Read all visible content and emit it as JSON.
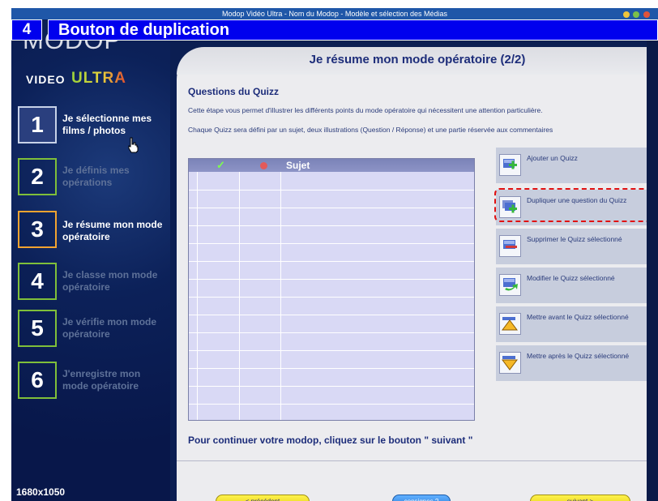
{
  "window": {
    "title": "Modop Vidéo Ultra - Nom du Modop - Modèle et sélection des Médias"
  },
  "caption": {
    "number": "4",
    "title": "Bouton de duplication"
  },
  "sidebar": {
    "logo_main": "MODOP",
    "logo_video": "VIDEO",
    "logo_ultra": "ULTRA",
    "steps": [
      {
        "num": "1",
        "label": "Je sélectionne mes films / photos"
      },
      {
        "num": "2",
        "label": "Je définis mes opérations"
      },
      {
        "num": "3",
        "label": "Je résume mon mode opératoire"
      },
      {
        "num": "4",
        "label": "Je classe mon mode opératoire"
      },
      {
        "num": "5",
        "label": "Je vérifie mon mode opératoire"
      },
      {
        "num": "6",
        "label": "J'enregistre mon mode opératoire"
      }
    ],
    "resolution": "1680x1050"
  },
  "main": {
    "title": "Je résume mon mode opératoire (2/2)",
    "section_title": "Questions du Quizz",
    "desc1": "Cette étape vous permet d'illustrer les différents points du mode opératoire qui nécessitent une attention particulière.",
    "desc2": "Chaque Quizz sera défini par un sujet, deux illustrations (Question / Réponse) et une partie réservée aux commentaires",
    "table": {
      "col_subject": "Sujet",
      "check_symbol": "✓",
      "rows": 14
    },
    "actions": [
      {
        "label": "Ajouter un Quizz",
        "icon": "add-quiz-icon"
      },
      {
        "label": "Dupliquer une question du Quizz",
        "icon": "duplicate-quiz-icon"
      },
      {
        "label": "Supprimer le Quizz sélectionné",
        "icon": "delete-quiz-icon"
      },
      {
        "label": "Modifier le Quizz sélectionné",
        "icon": "edit-quiz-icon"
      },
      {
        "label": "Mettre avant le Quizz sélectionné",
        "icon": "move-up-icon"
      },
      {
        "label": "Mettre après le Quizz sélectionné",
        "icon": "move-down-icon"
      }
    ],
    "continue_text": "Pour continuer votre modop, cliquez sur le bouton \" suivant \"",
    "buttons": {
      "prev": "< précédent",
      "instructions": "consignes ?",
      "next": "suivant >"
    }
  },
  "colors": {
    "caption_bg": "#0000ee",
    "sidebar_bg": "#0b1e52",
    "panel_bg": "#ececef",
    "title_text": "#1d2d7a",
    "step_border_green": "#7fbf3a",
    "step_border_orange": "#f2a330",
    "highlight_dash": "#e11111"
  }
}
